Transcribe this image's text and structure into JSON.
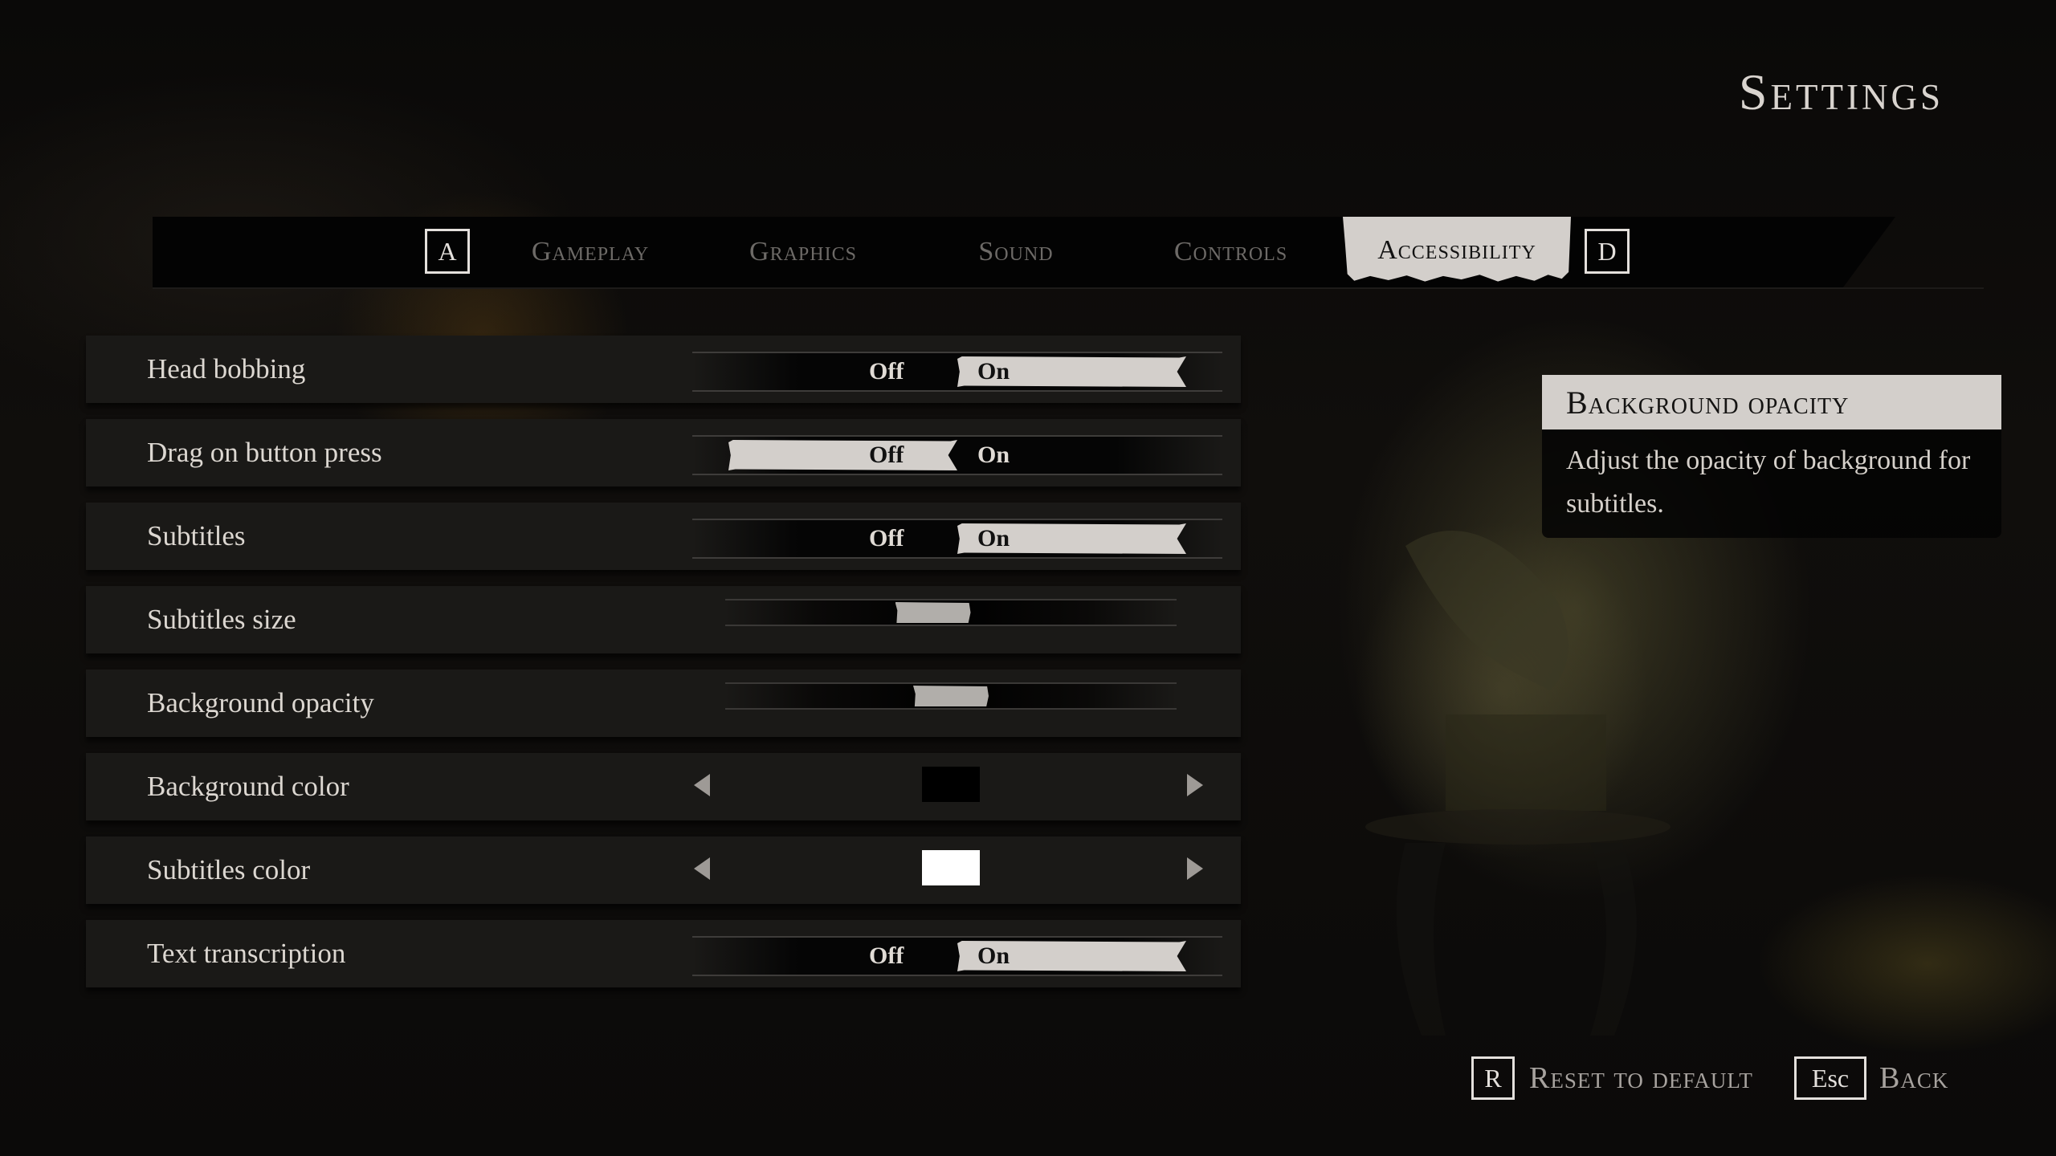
{
  "page": {
    "title": "Settings"
  },
  "tabs": {
    "prev_key": "A",
    "next_key": "D",
    "items": [
      {
        "label": "Gameplay",
        "active": false
      },
      {
        "label": "Graphics",
        "active": false
      },
      {
        "label": "Sound",
        "active": false
      },
      {
        "label": "Controls",
        "active": false
      },
      {
        "label": "Accessibility",
        "active": true
      }
    ]
  },
  "settings": [
    {
      "label": "Head bobbing",
      "type": "toggle",
      "off_label": "Off",
      "on_label": "On",
      "value": "On"
    },
    {
      "label": "Drag on button press",
      "type": "toggle",
      "off_label": "Off",
      "on_label": "On",
      "value": "Off"
    },
    {
      "label": "Subtitles",
      "type": "toggle",
      "off_label": "Off",
      "on_label": "On",
      "value": "On"
    },
    {
      "label": "Subtitles size",
      "type": "slider",
      "value": 0.46
    },
    {
      "label": "Background opacity",
      "type": "slider",
      "value": 0.5
    },
    {
      "label": "Background color",
      "type": "color",
      "value": "#000000",
      "prev_icon": "triangle-left-icon",
      "next_icon": "triangle-right-icon"
    },
    {
      "label": "Subtitles color",
      "type": "color",
      "value": "#ffffff",
      "prev_icon": "triangle-left-icon",
      "next_icon": "triangle-right-icon"
    },
    {
      "label": "Text transcription",
      "type": "toggle",
      "off_label": "Off",
      "on_label": "On",
      "value": "On"
    }
  ],
  "info_panel": {
    "title": "Background opacity",
    "description": "Adjust the opacity of background for subtitles."
  },
  "footer": {
    "reset_key": "R",
    "reset_label": "Reset to default",
    "back_key": "Esc",
    "back_label": "Back"
  },
  "colors": {
    "accent": "#d3cfcb",
    "text": "#dcd7d1",
    "inactive_tab": "#6d6a67",
    "row_bg": "#1a1917"
  }
}
